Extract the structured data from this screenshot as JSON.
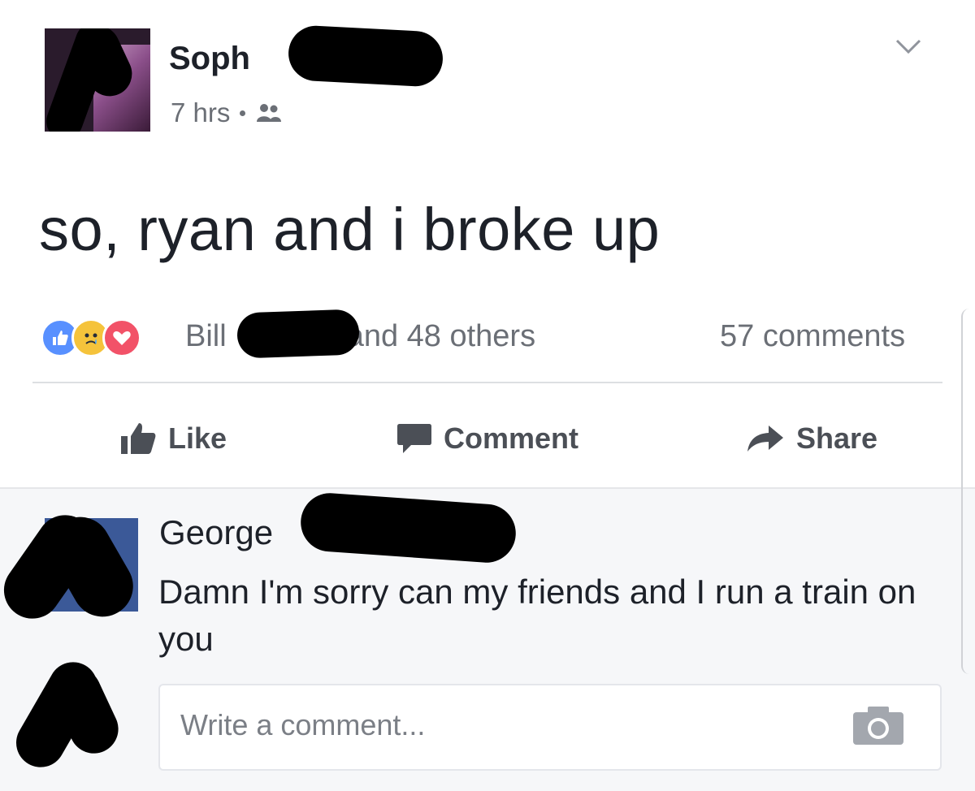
{
  "post": {
    "author_name": "Soph",
    "time": "7 hrs",
    "privacy_icon": "friends-icon",
    "text": "so, ryan and i broke up"
  },
  "reactions": {
    "icons": [
      "like-reaction-icon",
      "sad-reaction-icon",
      "love-reaction-icon"
    ],
    "name_prefix": "Bill",
    "suffix": "and 48 others",
    "comments_count": "57 comments"
  },
  "actions": {
    "like_label": "Like",
    "comment_label": "Comment",
    "share_label": "Share"
  },
  "comment": {
    "author": "George",
    "text": "Damn I'm sorry can my friends and I run a train on you"
  },
  "composer": {
    "placeholder": "Write a comment..."
  },
  "colors": {
    "like_blue": "#5890ff",
    "sad_yellow": "#f5c33b",
    "love_red": "#f25268",
    "muted_text": "#6b6f76",
    "action_text": "#4b4f56",
    "comment_bg": "#f6f7f9"
  }
}
